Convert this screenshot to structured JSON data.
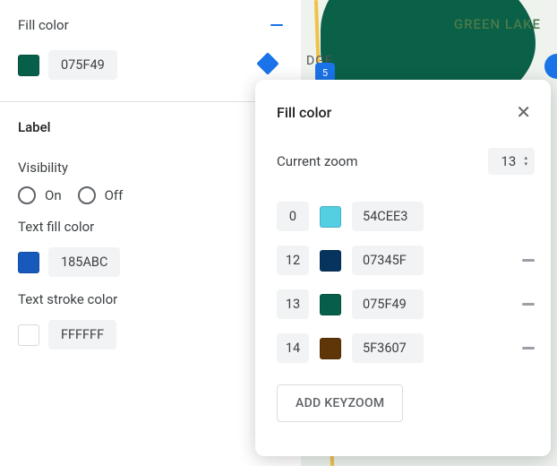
{
  "panel": {
    "fill": {
      "title": "Fill color",
      "hex": "075F49",
      "swatch": "#075F49"
    },
    "label_section_title": "Label",
    "visibility_label": "Visibility",
    "visibility": {
      "on_label": "On",
      "off_label": "Off"
    },
    "text_fill": {
      "label": "Text fill color",
      "hex": "185ABC",
      "swatch": "#185ABC"
    },
    "text_stroke": {
      "label": "Text stroke color",
      "hex": "FFFFFF",
      "swatch": "#FFFFFF"
    }
  },
  "map": {
    "label_green_lake": "GREEN LAKE",
    "label_dge": "DGE",
    "shield": "5"
  },
  "popover": {
    "title": "Fill color",
    "current_zoom_label": "Current zoom",
    "current_zoom_value": "13",
    "stops": [
      {
        "zoom": "0",
        "hex": "54CEE3",
        "swatch": "#54CEE3",
        "deletable": false
      },
      {
        "zoom": "12",
        "hex": "07345F",
        "swatch": "#07345F",
        "deletable": true
      },
      {
        "zoom": "13",
        "hex": "075F49",
        "swatch": "#075F49",
        "deletable": true
      },
      {
        "zoom": "14",
        "hex": "5F3607",
        "swatch": "#5F3607",
        "deletable": true
      }
    ],
    "add_button": "ADD KEYZOOM"
  }
}
